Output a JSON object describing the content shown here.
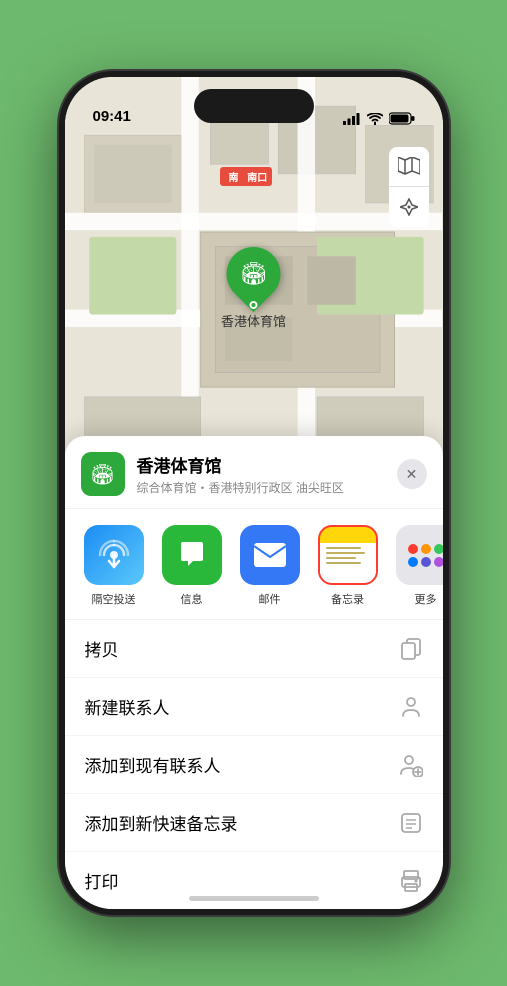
{
  "statusBar": {
    "time": "09:41",
    "signal": "●●●●",
    "wifi": "wifi",
    "battery": "battery"
  },
  "map": {
    "metroLabel": "南口",
    "controls": {
      "mapIcon": "🗺",
      "locationIcon": "⬆"
    }
  },
  "marker": {
    "label": "香港体育馆"
  },
  "venueSheet": {
    "name": "香港体育馆",
    "description": "综合体育馆・香港特别行政区 油尖旺区",
    "closeLabel": "✕"
  },
  "shareApps": [
    {
      "id": "airdrop",
      "label": "隔空投送",
      "type": "airdrop"
    },
    {
      "id": "messages",
      "label": "信息",
      "type": "messages"
    },
    {
      "id": "mail",
      "label": "邮件",
      "type": "mail"
    },
    {
      "id": "notes",
      "label": "备忘录",
      "type": "notes",
      "selected": true
    },
    {
      "id": "more",
      "label": "更多",
      "type": "more"
    }
  ],
  "actions": [
    {
      "id": "copy",
      "label": "拷贝",
      "icon": "copy"
    },
    {
      "id": "new-contact",
      "label": "新建联系人",
      "icon": "person"
    },
    {
      "id": "add-contact",
      "label": "添加到现有联系人",
      "icon": "add-person"
    },
    {
      "id": "quick-note",
      "label": "添加到新快速备忘录",
      "icon": "note"
    },
    {
      "id": "print",
      "label": "打印",
      "icon": "print"
    }
  ]
}
